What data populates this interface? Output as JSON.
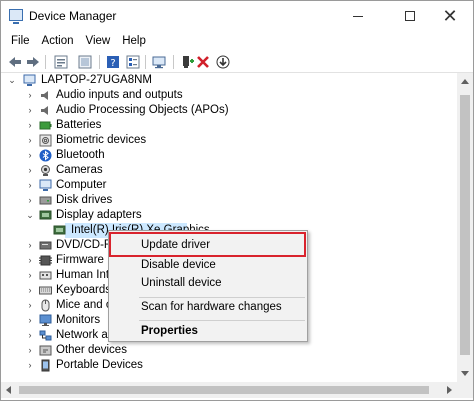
{
  "window": {
    "title": "Device Manager",
    "min_glyph": "",
    "close_glyph": "✕"
  },
  "menu": [
    "File",
    "Action",
    "View",
    "Help"
  ],
  "toolbar": {
    "icons": [
      "back-arrow-icon",
      "forward-arrow-icon",
      "properties-icon",
      "show-hidden-icon",
      "help-icon",
      "details-icon",
      "scan-hardware-icon",
      "add-driver-icon",
      "uninstall-icon",
      "update-driver-icon"
    ]
  },
  "tree": {
    "root": "LAPTOP-27UGA8NM",
    "items": [
      {
        "label": "Audio inputs and outputs",
        "icon": "speaker-icon",
        "expanded": false
      },
      {
        "label": "Audio Processing Objects (APOs)",
        "icon": "speaker-icon",
        "expanded": false
      },
      {
        "label": "Batteries",
        "icon": "battery-icon",
        "expanded": false
      },
      {
        "label": "Biometric devices",
        "icon": "fingerprint-icon",
        "expanded": false
      },
      {
        "label": "Bluetooth",
        "icon": "bluetooth-icon",
        "expanded": false
      },
      {
        "label": "Cameras",
        "icon": "camera-icon",
        "expanded": false
      },
      {
        "label": "Computer",
        "icon": "computer-icon",
        "expanded": false
      },
      {
        "label": "Disk drives",
        "icon": "disk-icon",
        "expanded": false
      },
      {
        "label": "Display adapters",
        "icon": "display-adapter-icon",
        "expanded": true
      },
      {
        "label": "Intel(R) Iris(R) Xe Graphics",
        "icon": "display-adapter-icon",
        "child": true,
        "selected": true
      },
      {
        "label": "DVD/CD-ROM drives",
        "icon": "dvd-icon",
        "expanded": false
      },
      {
        "label": "Firmware",
        "icon": "firmware-icon",
        "expanded": false
      },
      {
        "label": "Human Interface Devices",
        "icon": "hid-icon",
        "expanded": false
      },
      {
        "label": "Keyboards",
        "icon": "keyboard-icon",
        "expanded": false
      },
      {
        "label": "Mice and other pointing devices",
        "icon": "mouse-icon",
        "expanded": false
      },
      {
        "label": "Monitors",
        "icon": "monitor-icon",
        "expanded": false
      },
      {
        "label": "Network adapters",
        "icon": "network-icon",
        "expanded": false
      },
      {
        "label": "Other devices",
        "icon": "other-devices-icon",
        "expanded": false
      },
      {
        "label": "Portable Devices",
        "icon": "portable-devices-icon",
        "expanded": false
      }
    ]
  },
  "context_menu": {
    "items": [
      "Update driver",
      "Disable device",
      "Uninstall device",
      "Scan for hardware changes",
      "Properties"
    ],
    "highlighted": "Update driver",
    "highlight_color": "#d9232d"
  },
  "colors": {
    "selection": "#cce8ff",
    "menu_bg": "#f2f2f2"
  }
}
